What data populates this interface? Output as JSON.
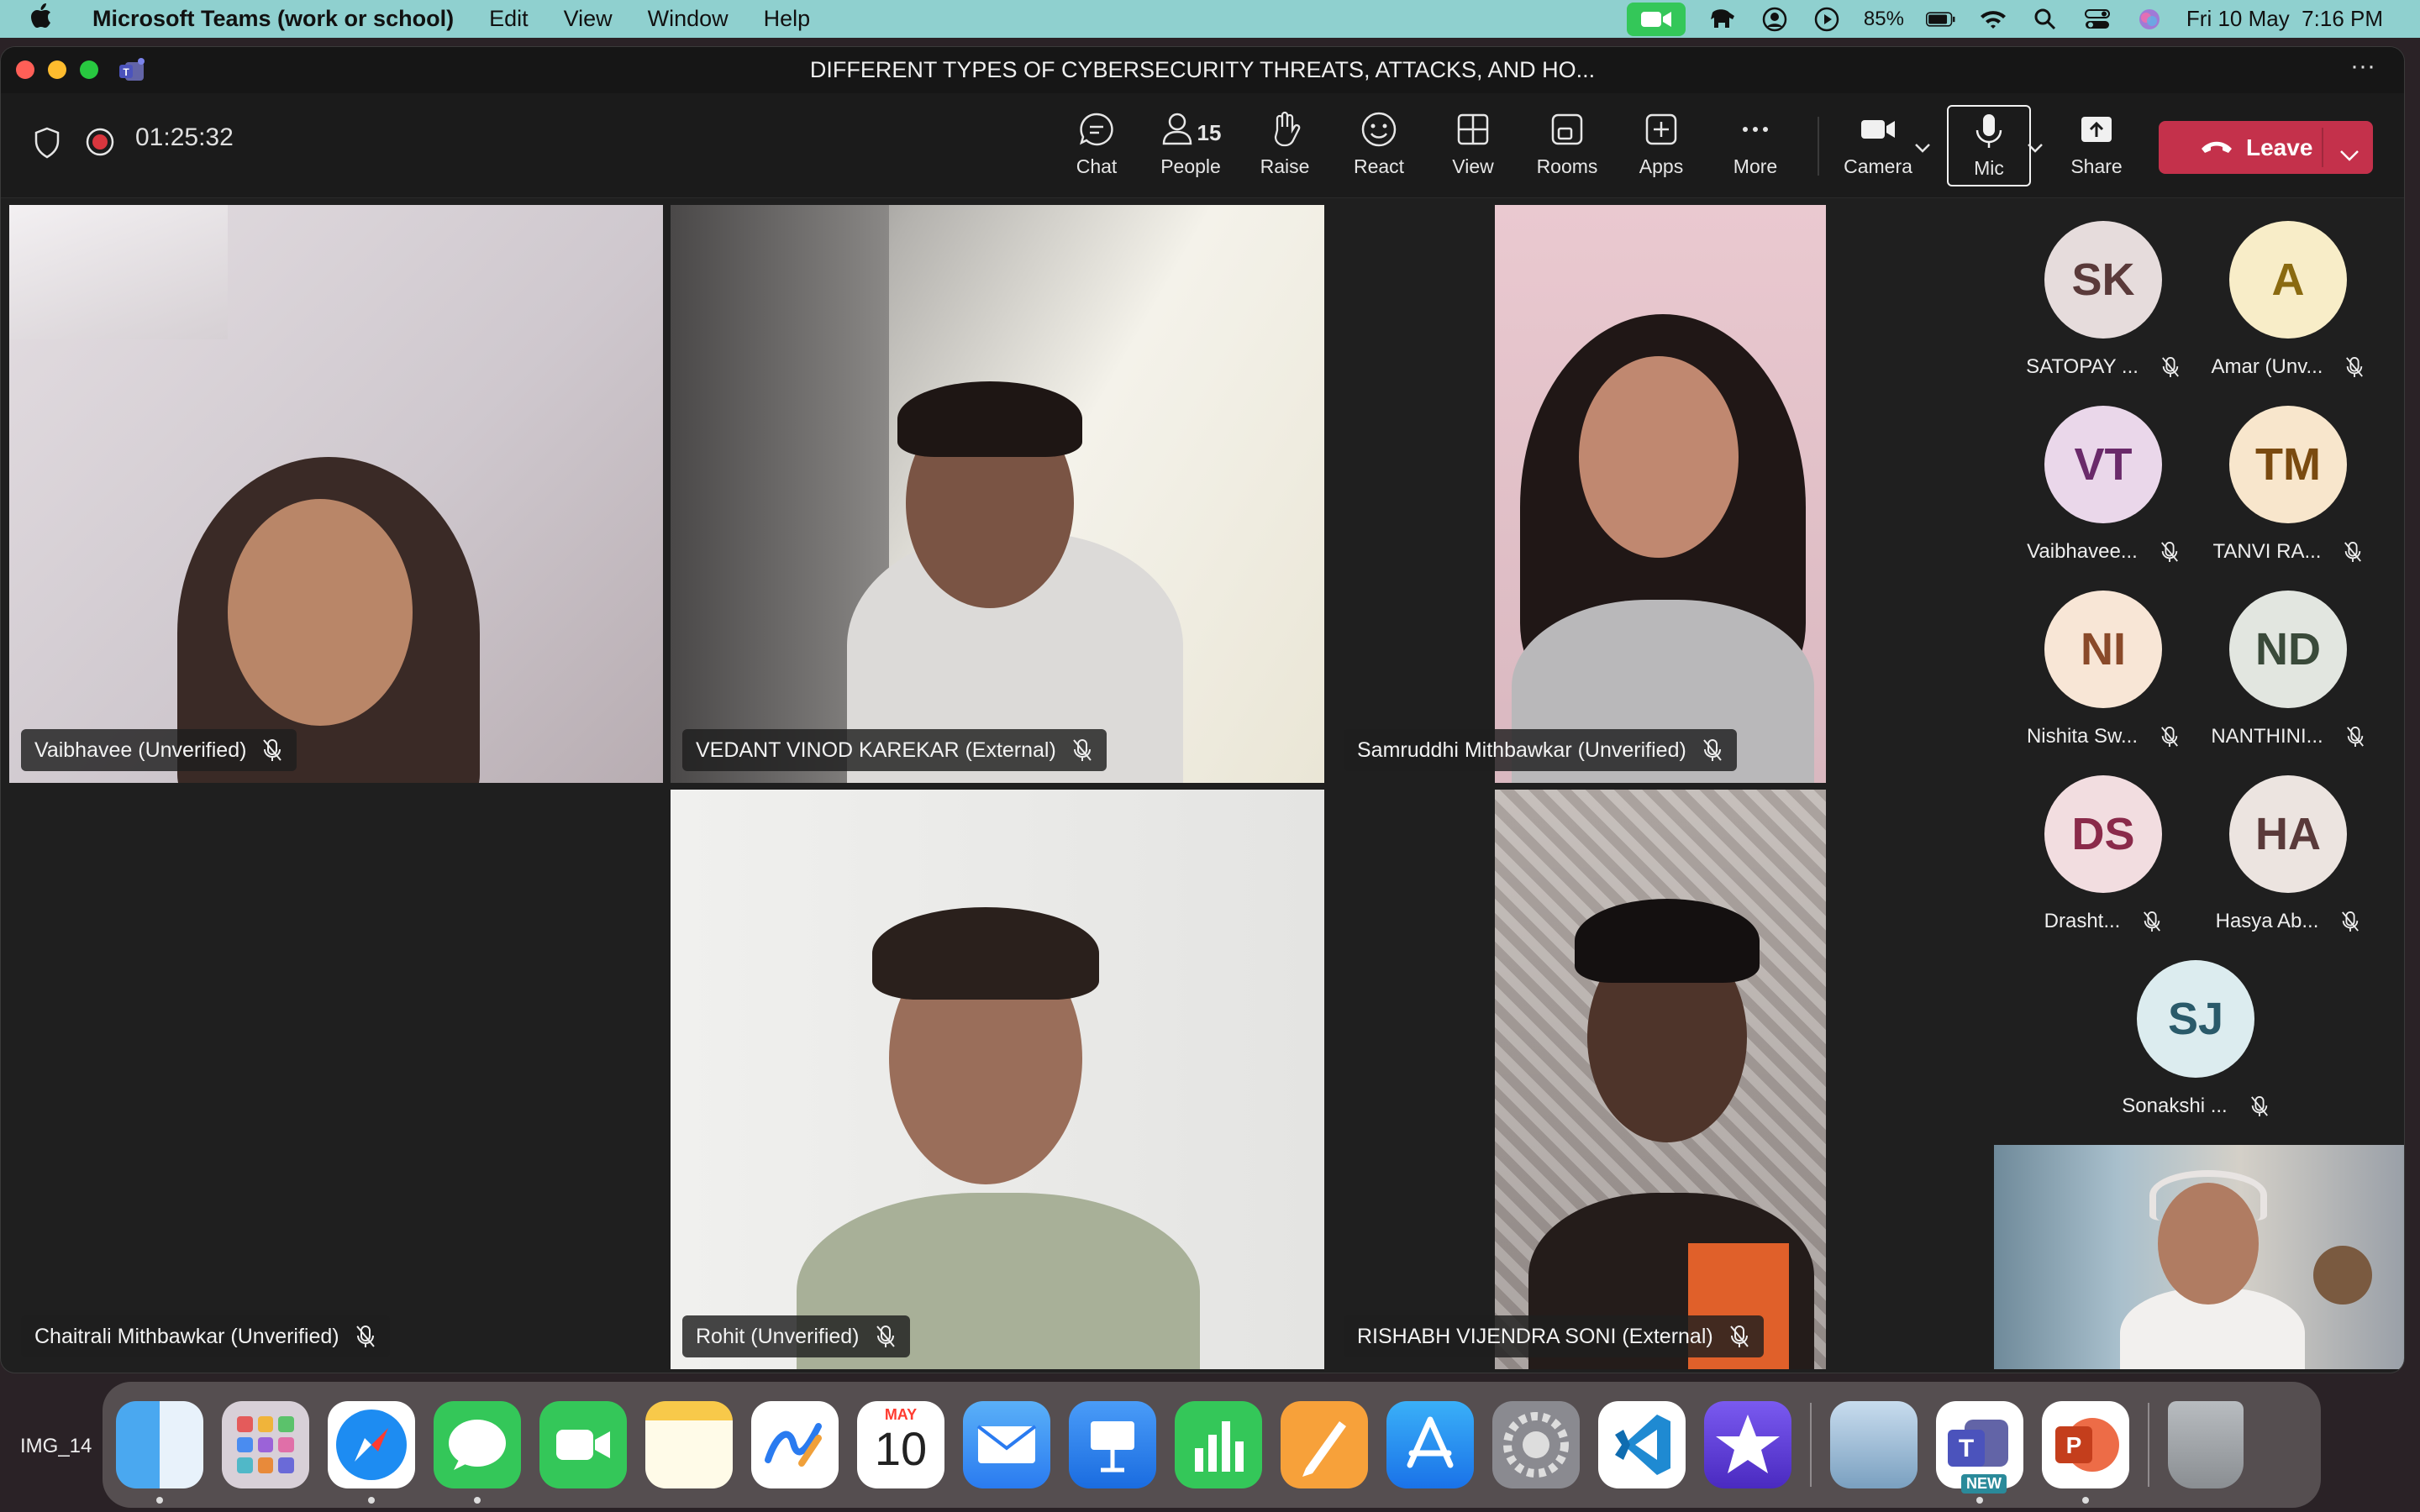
{
  "menubar": {
    "app_name": "Microsoft Teams (work or school)",
    "menus": [
      "Edit",
      "View",
      "Window",
      "Help"
    ],
    "battery": "85%",
    "datetime": "Fri 10 May  7:16 PM"
  },
  "window": {
    "title": "DIFFERENT TYPES OF CYBERSECURITY THREATS, ATTACKS, AND HO...",
    "more": "···"
  },
  "toolbar": {
    "timer": "01:25:32",
    "chat": "Chat",
    "people": "People",
    "people_count": "15",
    "raise": "Raise",
    "react": "React",
    "view": "View",
    "rooms": "Rooms",
    "apps": "Apps",
    "more": "More",
    "camera": "Camera",
    "mic": "Mic",
    "share": "Share",
    "leave": "Leave"
  },
  "tiles": [
    {
      "name": "Vaibhavee (Unverified)"
    },
    {
      "name": "VEDANT VINOD KAREKAR (External)"
    },
    {
      "name": "Samruddhi Mithbawkar (Unverified)"
    },
    {
      "name": "Chaitrali Mithbawkar (Unverified)"
    },
    {
      "name": "Rohit (Unverified)"
    },
    {
      "name": "RISHABH VIJENDRA SONI (External)"
    }
  ],
  "roster": [
    {
      "initials": "SK",
      "name": "SATOPAY ...",
      "bg": "#e6dcdc",
      "fg": "#5a3a3a"
    },
    {
      "initials": "A",
      "name": "Amar (Unv...",
      "bg": "#f8edc8",
      "fg": "#8a6a10"
    },
    {
      "initials": "VT",
      "name": "Vaibhavee...",
      "bg": "#ead7ea",
      "fg": "#6a2a6a"
    },
    {
      "initials": "TM",
      "name": "TANVI RA...",
      "bg": "#f8e6cc",
      "fg": "#7a4a10"
    },
    {
      "initials": "NI",
      "name": "Nishita Sw...",
      "bg": "#f8e6d6",
      "fg": "#8a4a2a"
    },
    {
      "initials": "ND",
      "name": "NANTHINI...",
      "bg": "#e2e6e0",
      "fg": "#3a4a3a"
    },
    {
      "initials": "DS",
      "name": "Drasht...",
      "bg": "#f2dde0",
      "fg": "#8a2a4a"
    },
    {
      "initials": "HA",
      "name": "Hasya Ab...",
      "bg": "#ece4e0",
      "fg": "#5a3a3a"
    },
    {
      "initials": "SJ",
      "name": "Sonakshi ...",
      "bg": "#dcecef",
      "fg": "#2a5a6a"
    }
  ],
  "dock": {
    "desktop_file": "IMG_14",
    "calendar_month": "MAY",
    "calendar_day": "10",
    "new_badge": "NEW"
  },
  "colors": {
    "leave_red": "#c4314b",
    "menubar": "#8fd0cf",
    "window_bg": "#1f1f1f"
  }
}
